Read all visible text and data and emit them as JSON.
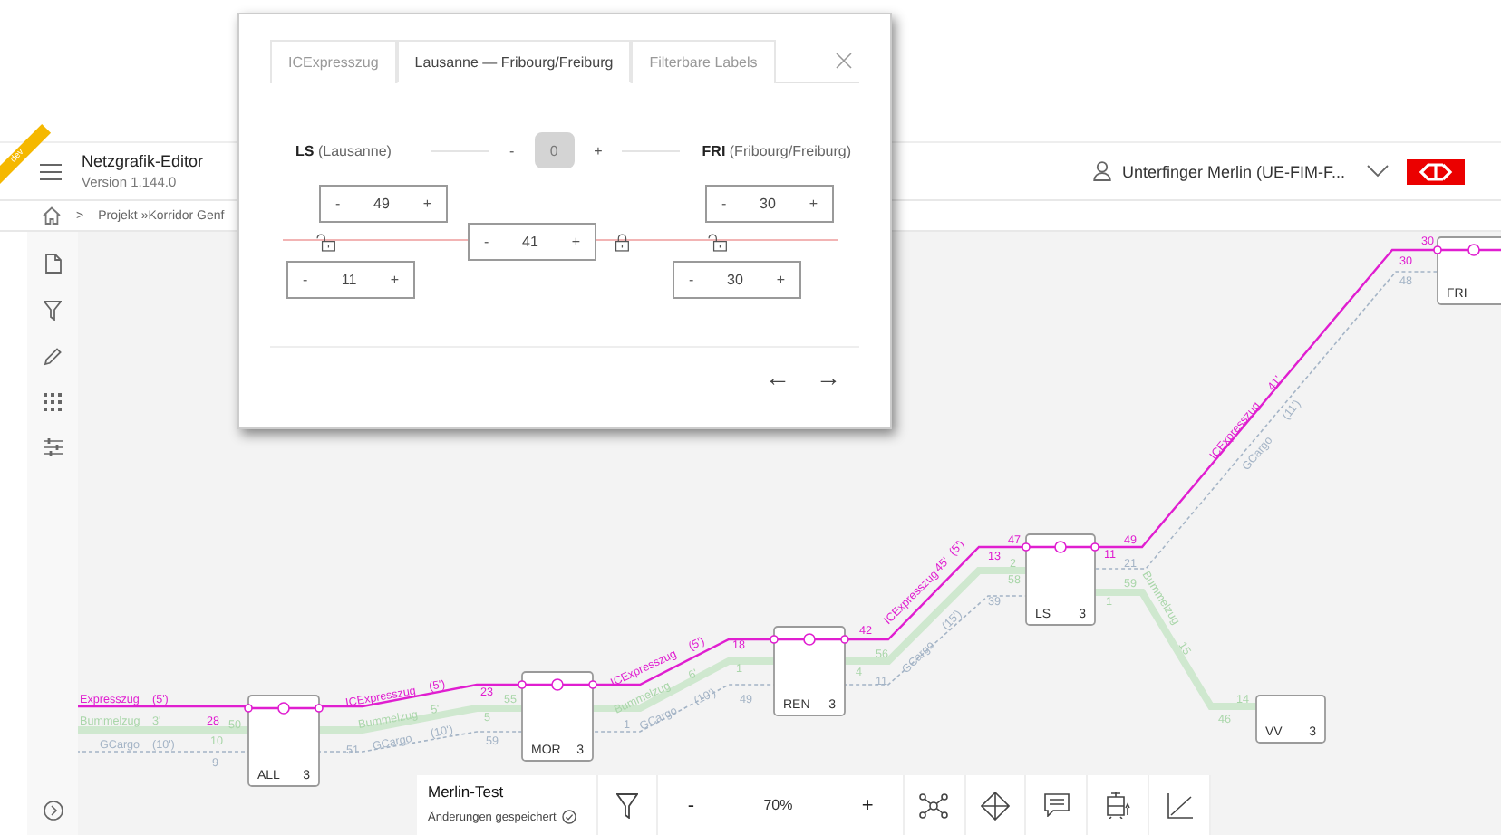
{
  "app": {
    "ribbon": "dev",
    "title": "Netzgrafik-Editor",
    "version": "Version 1.144.0"
  },
  "user": {
    "name": "Unterfinger Merlin (UE-FIM-F..."
  },
  "breadcrumb": {
    "separator": ">",
    "path": "Projekt »Korridor Genf"
  },
  "dialog": {
    "tabs": [
      {
        "label": "ICExpresszug",
        "selected": false
      },
      {
        "label": "Lausanne — Fribourg/Freiburg",
        "selected": true
      },
      {
        "label": "Filterbare Labels",
        "selected": false
      }
    ],
    "from_station": {
      "code": "LS",
      "name": "(Lausanne)"
    },
    "to_station": {
      "code": "FRI",
      "name": "(Fribourg/Freiburg)"
    },
    "stop_stepper": {
      "minus": "-",
      "value": "0",
      "plus": "+",
      "disabled": true
    },
    "steppers": [
      {
        "minus": "-",
        "value": "49",
        "plus": "+"
      },
      {
        "minus": "-",
        "value": "30",
        "plus": "+"
      },
      {
        "minus": "-",
        "value": "41",
        "plus": "+"
      },
      {
        "minus": "-",
        "value": "11",
        "plus": "+"
      },
      {
        "minus": "-",
        "value": "30",
        "plus": "+"
      }
    ],
    "locks": [
      {
        "locked": false
      },
      {
        "locked": true
      },
      {
        "locked": false
      }
    ],
    "nav": {
      "back": "←",
      "forward": "→"
    }
  },
  "graph": {
    "nodes": [
      {
        "name": "ALL",
        "count": "3"
      },
      {
        "name": "MOR",
        "count": "3"
      },
      {
        "name": "REN",
        "count": "3"
      },
      {
        "name": "LS",
        "count": "3"
      },
      {
        "name": "VV",
        "count": "3"
      },
      {
        "name": "FRI"
      }
    ],
    "labels": [
      {
        "text": "Expresszug",
        "kind": "ic"
      },
      {
        "text": "(5')",
        "kind": "ic"
      },
      {
        "text": "28",
        "kind": "ic"
      },
      {
        "text": "ICExpresszug",
        "kind": "ic"
      },
      {
        "text": "(5')",
        "kind": "ic"
      },
      {
        "text": "23",
        "kind": "ic"
      },
      {
        "text": "ICExpresszug",
        "kind": "ic"
      },
      {
        "text": "(5')",
        "kind": "ic"
      },
      {
        "text": "18",
        "kind": "ic"
      },
      {
        "text": "42",
        "kind": "ic"
      },
      {
        "text": "ICExpresszug",
        "kind": "ic"
      },
      {
        "text": "45'",
        "kind": "ic"
      },
      {
        "text": "(5')",
        "kind": "ic"
      },
      {
        "text": "47",
        "kind": "ic"
      },
      {
        "text": "13",
        "kind": "ic"
      },
      {
        "text": "11",
        "kind": "ic"
      },
      {
        "text": "49",
        "kind": "ic"
      },
      {
        "text": "ICExpresszug",
        "kind": "ic"
      },
      {
        "text": "41'",
        "kind": "ic"
      },
      {
        "text": "30",
        "kind": "ic"
      },
      {
        "text": "30",
        "kind": "ic"
      },
      {
        "text": "Bummelzug",
        "kind": "bummel"
      },
      {
        "text": "3'",
        "kind": "bummel"
      },
      {
        "text": "50",
        "kind": "bummel"
      },
      {
        "text": "10",
        "kind": "bummel"
      },
      {
        "text": "Bummelzug",
        "kind": "bummel"
      },
      {
        "text": "5'",
        "kind": "bummel"
      },
      {
        "text": "55",
        "kind": "bummel"
      },
      {
        "text": "5",
        "kind": "bummel"
      },
      {
        "text": "Bummelzug",
        "kind": "bummel"
      },
      {
        "text": "6'",
        "kind": "bummel"
      },
      {
        "text": "1",
        "kind": "bummel"
      },
      {
        "text": "56",
        "kind": "bummel"
      },
      {
        "text": "4",
        "kind": "bummel"
      },
      {
        "text": "2",
        "kind": "bummel"
      },
      {
        "text": "58",
        "kind": "bummel"
      },
      {
        "text": "59",
        "kind": "bummel"
      },
      {
        "text": "1",
        "kind": "bummel"
      },
      {
        "text": "Bummelzug",
        "kind": "bummel"
      },
      {
        "text": "15",
        "kind": "bummel"
      },
      {
        "text": "14",
        "kind": "bummel"
      },
      {
        "text": "46",
        "kind": "bummel"
      },
      {
        "text": "GCargo",
        "kind": "cargo"
      },
      {
        "text": "(10')",
        "kind": "cargo"
      },
      {
        "text": "9",
        "kind": "cargo"
      },
      {
        "text": "51",
        "kind": "cargo"
      },
      {
        "text": "GCargo",
        "kind": "cargo"
      },
      {
        "text": "(10')",
        "kind": "cargo"
      },
      {
        "text": "59",
        "kind": "cargo"
      },
      {
        "text": "1",
        "kind": "cargo"
      },
      {
        "text": "GCargo",
        "kind": "cargo"
      },
      {
        "text": "(10')",
        "kind": "cargo"
      },
      {
        "text": "49",
        "kind": "cargo"
      },
      {
        "text": "11",
        "kind": "cargo"
      },
      {
        "text": "GCargo",
        "kind": "cargo"
      },
      {
        "text": "(15')",
        "kind": "cargo"
      },
      {
        "text": "39",
        "kind": "cargo"
      },
      {
        "text": "21",
        "kind": "cargo"
      },
      {
        "text": "GCargo",
        "kind": "cargo"
      },
      {
        "text": "(11')",
        "kind": "cargo"
      },
      {
        "text": "48",
        "kind": "cargo"
      }
    ]
  },
  "toolbar": {
    "title": "Merlin-Test",
    "status": "Änderungen gespeichert",
    "zoom_out": "-",
    "zoom": "70%",
    "zoom_in": "+"
  }
}
